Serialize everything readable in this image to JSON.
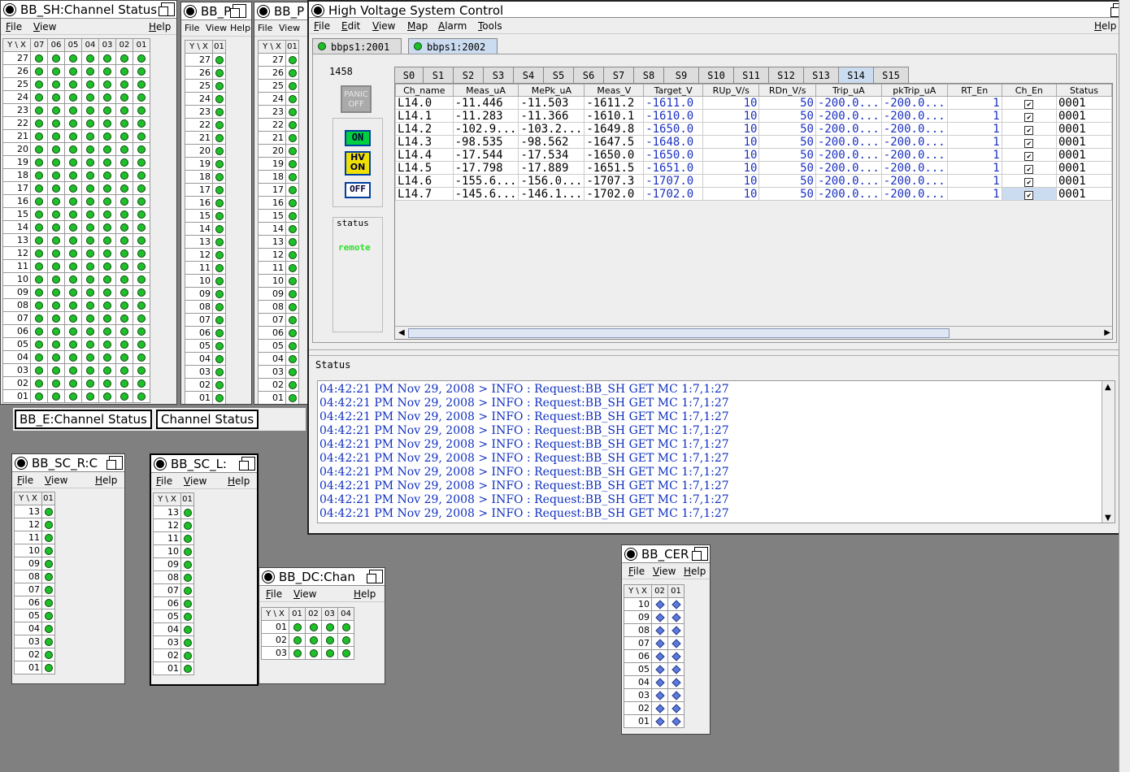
{
  "bb_sh": {
    "title": "BB_SH:Channel Status",
    "menu": {
      "file": "File",
      "view": "View",
      "help": "Help"
    },
    "corner": "Y \\ X",
    "cols": [
      "07",
      "06",
      "05",
      "04",
      "03",
      "02",
      "01"
    ],
    "rows": [
      "27",
      "26",
      "25",
      "24",
      "23",
      "22",
      "21",
      "20",
      "19",
      "18",
      "17",
      "16",
      "15",
      "14",
      "13",
      "12",
      "11",
      "10",
      "09",
      "08",
      "07",
      "06",
      "05",
      "04",
      "03",
      "02",
      "01"
    ]
  },
  "bb_p1": {
    "title": "BB_P",
    "menu": {
      "file": "File",
      "view": "View",
      "help": "Help"
    },
    "corner": "Y \\ X",
    "cols": [
      "01"
    ]
  },
  "bb_p2": {
    "title": "BB_P",
    "menu": {
      "file": "File",
      "view": "View"
    },
    "corner": "Y \\ X",
    "cols": [
      "01"
    ]
  },
  "bb_e_label": "BB_E:Channel Status",
  "channel_status_label": "Channel Status",
  "bb_sc_r": {
    "title": "BB_SC_R:C",
    "menu": {
      "file": "File",
      "view": "View",
      "help": "Help"
    },
    "corner": "Y \\ X",
    "cols": [
      "01"
    ],
    "rows": [
      "13",
      "12",
      "11",
      "10",
      "09",
      "08",
      "07",
      "06",
      "05",
      "04",
      "03",
      "02",
      "01"
    ]
  },
  "bb_sc_l": {
    "title": "BB_SC_L:",
    "menu": {
      "file": "File",
      "view": "View",
      "help": "Help"
    },
    "corner": "Y \\ X",
    "cols": [
      "01"
    ],
    "rows": [
      "13",
      "12",
      "11",
      "10",
      "09",
      "08",
      "07",
      "06",
      "05",
      "04",
      "03",
      "02",
      "01"
    ]
  },
  "bb_dc": {
    "title": "BB_DC:Chan",
    "menu": {
      "file": "File",
      "view": "View",
      "help": "Help"
    },
    "corner": "Y \\ X",
    "cols": [
      "01",
      "02",
      "03",
      "04"
    ],
    "rows": [
      "01",
      "02",
      "03"
    ]
  },
  "bb_cer": {
    "title": "BB_CER",
    "menu": {
      "file": "File",
      "view": "View",
      "help": "Help"
    },
    "corner": "Y \\ X",
    "cols": [
      "02",
      "01"
    ],
    "rows": [
      "10",
      "09",
      "08",
      "07",
      "06",
      "05",
      "04",
      "03",
      "02",
      "01"
    ]
  },
  "hv": {
    "title": "High Voltage System Control",
    "menu": {
      "file": "File",
      "edit": "Edit",
      "view": "View",
      "map": "Map",
      "alarm": "Alarm",
      "tools": "Tools",
      "help": "Help"
    },
    "server_tabs": [
      "bbps1:2001",
      "bbps1:2002"
    ],
    "crate_number": "1458",
    "panic": "PANIC OFF",
    "btn_on": "ON",
    "btn_hv_on": "HV ON",
    "btn_off": "OFF",
    "status_label": "status",
    "status_value": "remote",
    "slot_tabs": [
      "S0",
      "S1",
      "S2",
      "S3",
      "S4",
      "S5",
      "S6",
      "S7",
      "S8",
      "S9",
      "S10",
      "S11",
      "S12",
      "S13",
      "S14",
      "S15"
    ],
    "selected_slot": "S14",
    "columns": [
      "Ch_name",
      "Meas_uA",
      "MePk_uA",
      "Meas_V",
      "Target_V",
      "RUp_V/s",
      "RDn_V/s",
      "Trip_uA",
      "pkTrip_uA",
      "RT_En",
      "Ch_En",
      "Status"
    ],
    "rows": [
      [
        "L14.0",
        "-11.446",
        "-11.503",
        "-1611.2",
        "-1611.0",
        "10",
        "50",
        "-200.0...",
        "-200.0...",
        "1",
        "✔",
        "0001"
      ],
      [
        "L14.1",
        "-11.283",
        "-11.366",
        "-1610.1",
        "-1610.0",
        "10",
        "50",
        "-200.0...",
        "-200.0...",
        "1",
        "✔",
        "0001"
      ],
      [
        "L14.2",
        "-102.9...",
        "-103.2...",
        "-1649.8",
        "-1650.0",
        "10",
        "50",
        "-200.0...",
        "-200.0...",
        "1",
        "✔",
        "0001"
      ],
      [
        "L14.3",
        "-98.535",
        "-98.562",
        "-1647.5",
        "-1648.0",
        "10",
        "50",
        "-200.0...",
        "-200.0...",
        "1",
        "✔",
        "0001"
      ],
      [
        "L14.4",
        "-17.544",
        "-17.534",
        "-1650.0",
        "-1650.0",
        "10",
        "50",
        "-200.0...",
        "-200.0...",
        "1",
        "✔",
        "0001"
      ],
      [
        "L14.5",
        "-17.798",
        "-17.889",
        "-1651.5",
        "-1651.0",
        "10",
        "50",
        "-200.0...",
        "-200.0...",
        "1",
        "✔",
        "0001"
      ],
      [
        "L14.6",
        "-155.6...",
        "-156.0...",
        "-1707.3",
        "-1707.0",
        "10",
        "50",
        "-200.0...",
        "-200.0...",
        "1",
        "✔",
        "0001"
      ],
      [
        "L14.7",
        "-145.6...",
        "-146.1...",
        "-1702.0",
        "-1702.0",
        "10",
        "50",
        "-200.0...",
        "-200.0...",
        "1",
        "✔",
        "0001"
      ]
    ],
    "status_section": "Status",
    "log": [
      "04:42:21 PM Nov 29, 2008 > INFO : Request:BB_SH GET MC 1:7,1:27",
      "04:42:21 PM Nov 29, 2008 > INFO : Request:BB_SH GET MC 1:7,1:27",
      "04:42:21 PM Nov 29, 2008 > INFO : Request:BB_SH GET MC 1:7,1:27",
      "04:42:21 PM Nov 29, 2008 > INFO : Request:BB_SH GET MC 1:7,1:27",
      "04:42:21 PM Nov 29, 2008 > INFO : Request:BB_SH GET MC 1:7,1:27",
      "04:42:21 PM Nov 29, 2008 > INFO : Request:BB_SH GET MC 1:7,1:27",
      "04:42:21 PM Nov 29, 2008 > INFO : Request:BB_SH GET MC 1:7,1:27",
      "04:42:21 PM Nov 29, 2008 > INFO : Request:BB_SH GET MC 1:7,1:27",
      "04:42:21 PM Nov 29, 2008 > INFO : Request:BB_SH GET MC 1:7,1:27",
      "04:42:21 PM Nov 29, 2008 > INFO : Request:BB_SH GET MC 1:7,1:27"
    ]
  },
  "colors": {
    "led_green": "#1fbf2a",
    "diamond_blue": "#5a7ae0",
    "log_text": "#1030c0",
    "status_remote": "#30e030"
  }
}
